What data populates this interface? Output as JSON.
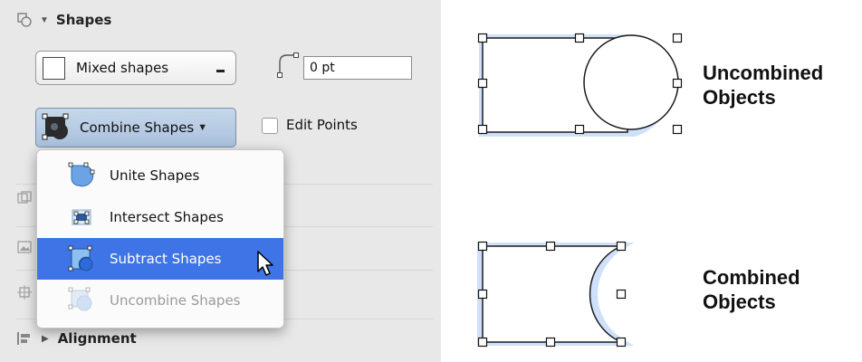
{
  "panel": {
    "section_title": "Shapes",
    "fill_popup_label": "Mixed shapes",
    "stroke_width_value": "0 pt",
    "combine_button_label": "Combine Shapes",
    "edit_points_label": "Edit Points",
    "alignment_title": "Alignment"
  },
  "menu": {
    "items": [
      {
        "label": "Unite Shapes",
        "icon": "unite-shapes-icon",
        "state": "normal"
      },
      {
        "label": "Intersect Shapes",
        "icon": "intersect-shapes-icon",
        "state": "normal"
      },
      {
        "label": "Subtract Shapes",
        "icon": "subtract-shapes-icon",
        "state": "selected"
      },
      {
        "label": "Uncombine Shapes",
        "icon": "uncombine-shapes-icon",
        "state": "disabled"
      }
    ]
  },
  "illustration": {
    "uncombined_caption": [
      "Uncombined",
      "Objects"
    ],
    "combined_caption": [
      "Combined",
      "Objects"
    ]
  },
  "colors": {
    "highlight": "#3f74e7",
    "selection_glow": "#cfe0fb"
  }
}
